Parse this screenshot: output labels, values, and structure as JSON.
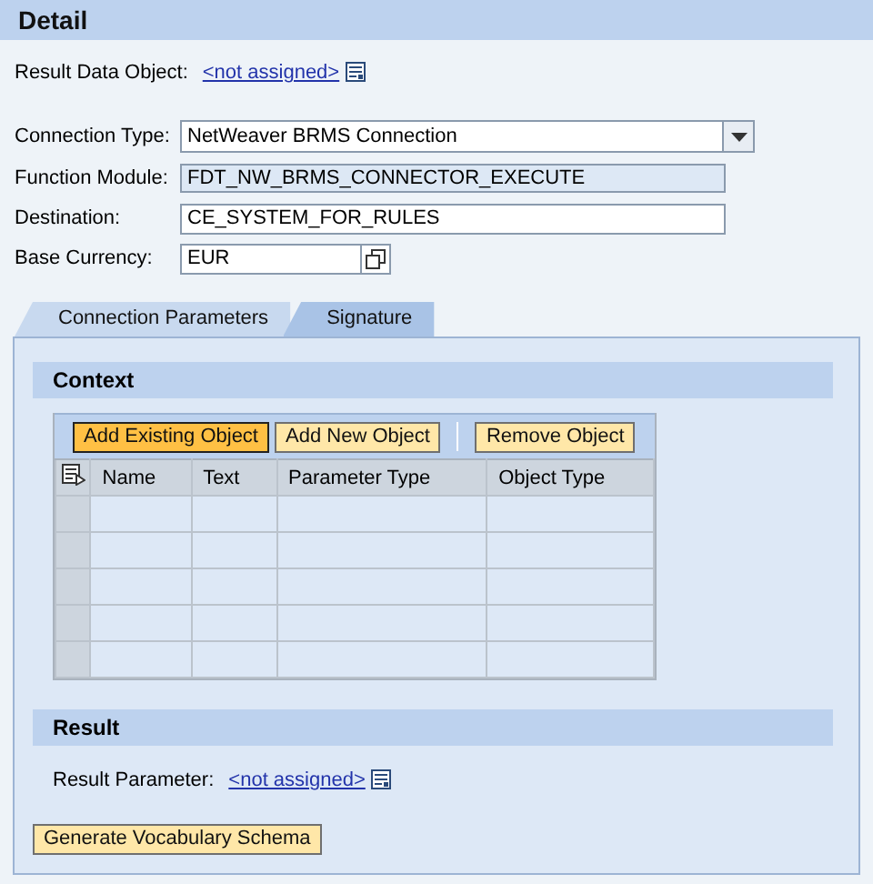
{
  "title": "Detail",
  "result_data_object": {
    "label": "Result Data Object:",
    "link": "<not assigned>"
  },
  "form": [
    {
      "kind": "dropdown",
      "label": "Connection Type:",
      "value": "NetWeaver BRMS  Connection"
    },
    {
      "kind": "readonly",
      "label": "Function Module:",
      "value": "FDT_NW_BRMS_CONNECTOR_EXECUTE"
    },
    {
      "kind": "text",
      "label": "Destination:",
      "value": "CE_SYSTEM_FOR_RULES"
    },
    {
      "kind": "valuehelp",
      "label": "Base Currency:",
      "value": "EUR"
    }
  ],
  "tabs": [
    {
      "label": "Connection Parameters",
      "selected": false
    },
    {
      "label": "Signature",
      "selected": true
    }
  ],
  "context": {
    "title": "Context",
    "toolbar": [
      {
        "label": "Add Existing Object",
        "emphasized": true,
        "separator_before": false
      },
      {
        "label": "Add New Object",
        "emphasized": false,
        "separator_before": false
      },
      {
        "label": "Remove Object",
        "emphasized": false,
        "separator_before": true
      }
    ],
    "columns": [
      "Name",
      "Text",
      "Parameter Type",
      "Object Type"
    ]
  },
  "result": {
    "title": "Result",
    "label": "Result Parameter:",
    "link": "<not assigned>"
  },
  "generate_button": "Generate Vocabulary Schema"
}
